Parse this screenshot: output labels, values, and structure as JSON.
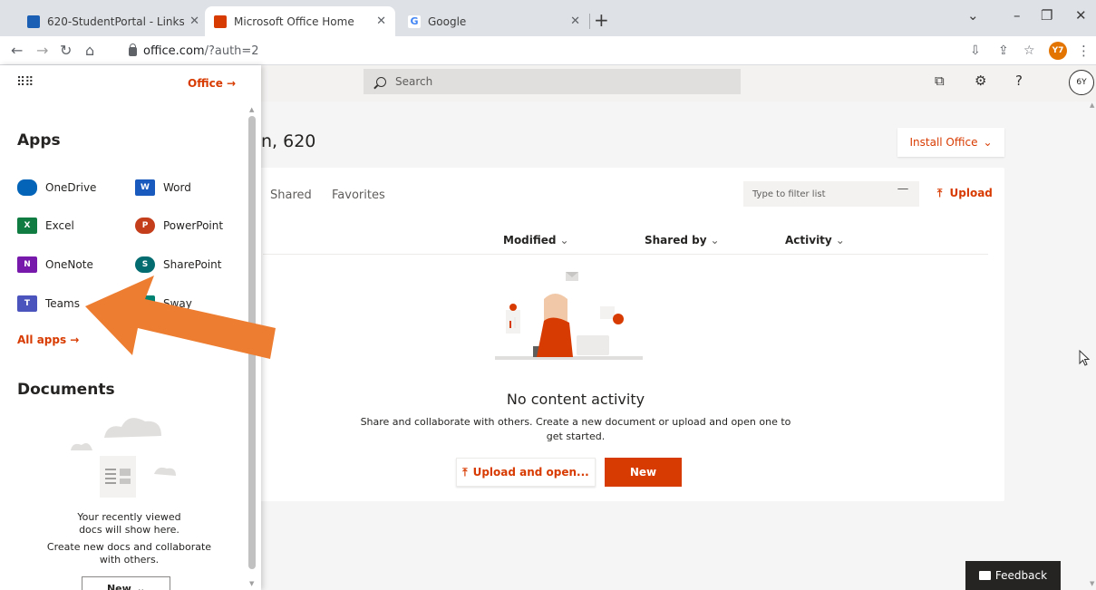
{
  "browser": {
    "tabs": [
      {
        "label": "620-StudentPortal - Links",
        "active": false
      },
      {
        "label": "Microsoft Office Home",
        "active": true
      },
      {
        "label": "Google",
        "active": false
      }
    ],
    "url_host": "office.com",
    "url_path": "/?auth=2",
    "profile_initials": "Y7"
  },
  "officebar": {
    "search_placeholder": "Search",
    "user_initials": "6Y"
  },
  "panel": {
    "office_link": "Office →",
    "apps_title": "Apps",
    "apps": [
      {
        "name": "OneDrive",
        "icon": "onedrive-icon",
        "color": "#0364b8"
      },
      {
        "name": "Word",
        "icon": "word-icon",
        "color": "#185abd"
      },
      {
        "name": "Excel",
        "icon": "excel-icon",
        "color": "#107c41"
      },
      {
        "name": "PowerPoint",
        "icon": "powerpoint-icon",
        "color": "#c43e1c"
      },
      {
        "name": "OneNote",
        "icon": "onenote-icon",
        "color": "#7719aa"
      },
      {
        "name": "SharePoint",
        "icon": "sharepoint-icon",
        "color": "#036c70"
      },
      {
        "name": "Teams",
        "icon": "teams-icon",
        "color": "#4b53bc"
      },
      {
        "name": "Sway",
        "icon": "sway-icon",
        "color": "#008272"
      }
    ],
    "all_apps": "All apps →",
    "documents_title": "Documents",
    "docs_line1": "Your recently viewed",
    "docs_line2": "docs will show here.",
    "docs_line3": "Create new docs and collaborate",
    "docs_line4": "with others.",
    "new_label": "New"
  },
  "main": {
    "greeting": "n, 620",
    "install_office": "Install Office",
    "tabs": [
      "Shared",
      "Favorites"
    ],
    "filter_placeholder": "Type to filter list",
    "upload_label": "Upload",
    "columns": [
      "Modified",
      "Shared by",
      "Activity"
    ],
    "empty_title": "No content activity",
    "empty_desc_line1": "Share and collaborate with others. Create a new document or upload and open one to",
    "empty_desc_line2": "get started.",
    "upload_open_label": "Upload and open...",
    "new_label": "New"
  },
  "feedback_label": "Feedback",
  "colors": {
    "accent": "#d83b01",
    "arrow": "#ed7d31"
  }
}
